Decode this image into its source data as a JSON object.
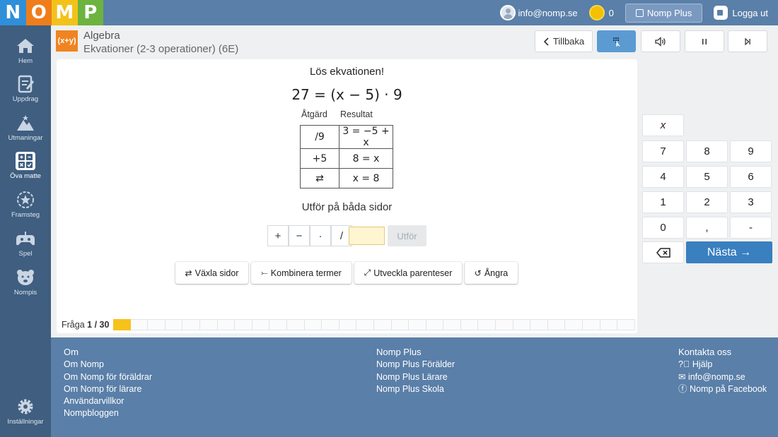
{
  "logo": {
    "letters": [
      "N",
      "O",
      "M",
      "P"
    ],
    "colors": [
      "#2f8fd9",
      "#ef7d1a",
      "#f3c21a",
      "#6db33f"
    ]
  },
  "topbar": {
    "user_email": "info@nomp.se",
    "coins": "0",
    "plus_label": "Nomp Plus",
    "logout_label": "Logga ut"
  },
  "sidebar": {
    "items": [
      {
        "label": "Hem",
        "icon": "home-icon"
      },
      {
        "label": "Uppdrag",
        "icon": "clipboard-icon"
      },
      {
        "label": "Utmaningar",
        "icon": "mountain-icon"
      },
      {
        "label": "Öva matte",
        "icon": "calculator-icon",
        "active": true
      },
      {
        "label": "Framsteg",
        "icon": "star-icon"
      },
      {
        "label": "Spel",
        "icon": "gamepad-icon"
      },
      {
        "label": "Nompis",
        "icon": "bear-icon"
      }
    ],
    "settings_label": "Inställningar"
  },
  "header": {
    "badge": "(x+y)",
    "subject": "Algebra",
    "lesson": "Ekvationer (2-3 operationer) (6E)",
    "back_label": "Tillbaka"
  },
  "exercise": {
    "prompt": "Lös ekvationen!",
    "equation": "27 = (x − 5) · 9",
    "col_action": "Åtgärd",
    "col_result": "Resultat",
    "steps": [
      {
        "action": "/9",
        "result": "3 = −5 + x"
      },
      {
        "action": "+5",
        "result": "8 = x"
      },
      {
        "action": "⇄",
        "result": "x = 8"
      }
    ],
    "instruction": "Utför på båda sidor",
    "operators": [
      "+",
      "−",
      "·",
      "/"
    ],
    "run_label": "Utför",
    "actions": [
      "Växla sidor",
      "Kombinera termer",
      "Utveckla parenteser",
      "Ångra"
    ],
    "question_label": "Fråga",
    "question_progress": "1 / 30",
    "progress_done": 1,
    "progress_total": 30
  },
  "keypad": {
    "var_key": "x",
    "keys": [
      "7",
      "8",
      "9",
      "4",
      "5",
      "6",
      "1",
      "2",
      "3",
      "0",
      ",",
      "-"
    ],
    "next_label": "Nästa →"
  },
  "footer": {
    "col1": {
      "title": "Om",
      "links": [
        "Om Nomp",
        "Om Nomp för föräldrar",
        "Om Nomp för lärare",
        "Användarvillkor",
        "Nompbloggen"
      ]
    },
    "col2": {
      "title": "Nomp Plus",
      "links": [
        "Nomp Plus Förälder",
        "Nomp Plus Lärare",
        "Nomp Plus Skola"
      ]
    },
    "col3": {
      "title": "Kontakta oss",
      "links": [
        "Hjälp",
        "info@nomp.se",
        "Nomp på Facebook"
      ]
    }
  }
}
